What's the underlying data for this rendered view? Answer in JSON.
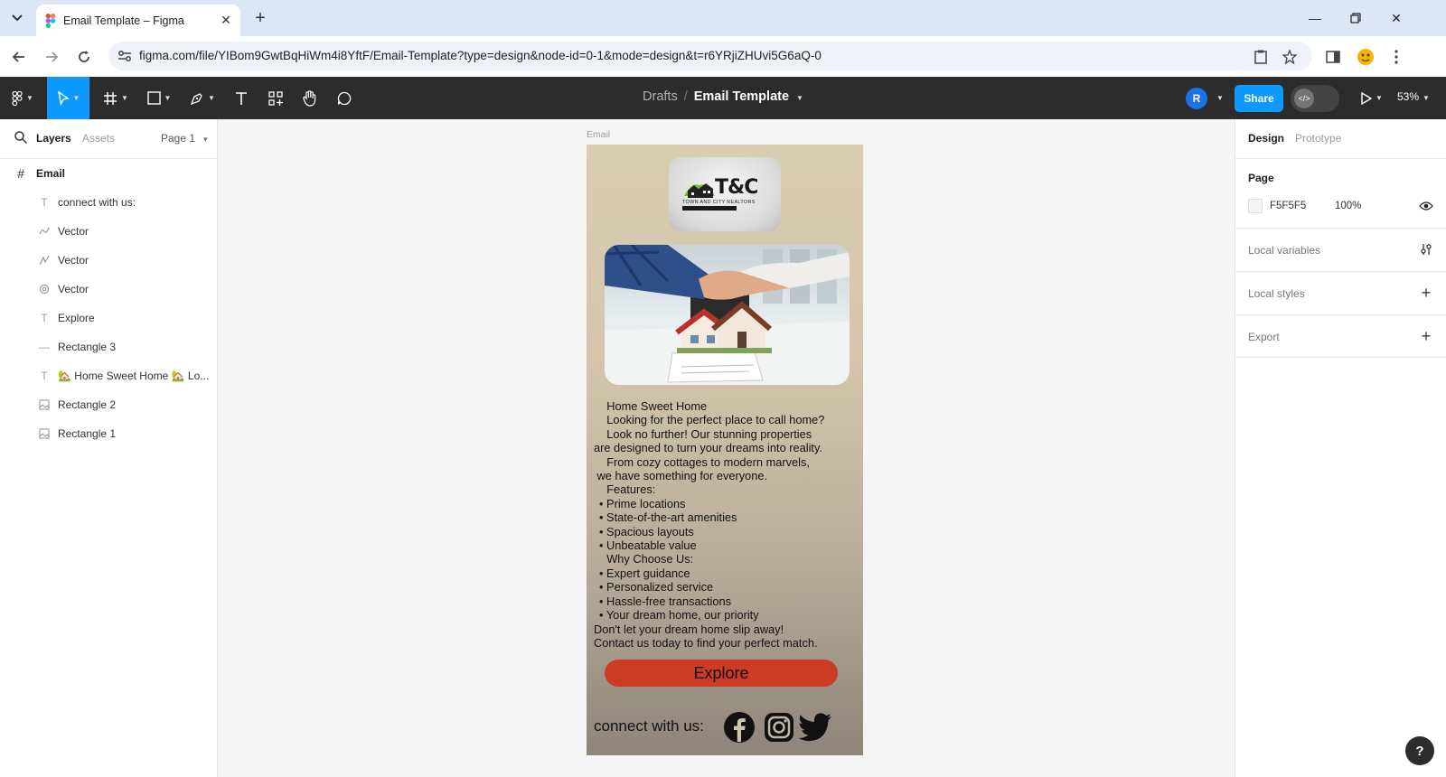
{
  "browser": {
    "tab_title": "Email Template – Figma",
    "url": "figma.com/file/YIBom9GwtBqHiWm4i8YftF/Email-Template?type=design&node-id=0-1&mode=design&t=r6YRjiZHUvi5G6aQ-0"
  },
  "toolbar": {
    "breadcrumb_drafts": "Drafts",
    "breadcrumb_sep": "/",
    "file_name": "Email Template",
    "avatar_initial": "R",
    "share_label": "Share",
    "zoom": "53%"
  },
  "left_panel": {
    "tab_layers": "Layers",
    "tab_assets": "Assets",
    "page_selector": "Page 1",
    "frame_name": "Email",
    "layers": [
      {
        "name": "connect with us:",
        "icon": "text-icon"
      },
      {
        "name": "Vector",
        "icon": "vector-icon"
      },
      {
        "name": "Vector",
        "icon": "vector-icon"
      },
      {
        "name": "Vector",
        "icon": "vector-icon"
      },
      {
        "name": "Explore",
        "icon": "text-icon"
      },
      {
        "name": "Rectangle 3",
        "icon": "rectangle-icon"
      },
      {
        "name": "🏡 Home Sweet Home 🏡 Lo...",
        "icon": "text-icon"
      },
      {
        "name": "Rectangle 2",
        "icon": "image-icon"
      },
      {
        "name": "Rectangle 1",
        "icon": "image-icon"
      }
    ]
  },
  "canvas": {
    "frame_label": "Email",
    "email": {
      "logo_text": "T&C",
      "logo_subtext": "TOWN AND CITY REALTORS",
      "body_lines": [
        {
          "t": "    Home Sweet Home",
          "b": false
        },
        {
          "t": "    Looking for the perfect place to call home?",
          "b": false
        },
        {
          "t": "    Look no further! Our stunning properties",
          "b": false
        },
        {
          "t": "are designed to turn your dreams into reality.",
          "b": false
        },
        {
          "t": "    From cozy cottages to modern marvels,",
          "b": false
        },
        {
          "t": " we have something for everyone.",
          "b": false
        },
        {
          "t": "    Features:",
          "b": false
        },
        {
          "t": "Prime locations",
          "b": true
        },
        {
          "t": "State-of-the-art amenities",
          "b": true
        },
        {
          "t": "Spacious layouts",
          "b": true
        },
        {
          "t": "Unbeatable value",
          "b": true
        },
        {
          "t": "    Why Choose Us:",
          "b": false
        },
        {
          "t": "Expert guidance",
          "b": true
        },
        {
          "t": "Personalized service",
          "b": true
        },
        {
          "t": "Hassle-free transactions",
          "b": true
        },
        {
          "t": "Your dream home, our priority",
          "b": true
        },
        {
          "t": "Don't let your dream home slip away!",
          "b": false
        },
        {
          "t": "Contact us today to find your perfect match.",
          "b": false
        }
      ],
      "explore_label": "Explore",
      "connect_label": "connect with us:",
      "button_color": "#cc3b23"
    }
  },
  "right_panel": {
    "tab_design": "Design",
    "tab_prototype": "Prototype",
    "page_title": "Page",
    "page_color": "F5F5F5",
    "page_opacity": "100%",
    "local_variables": "Local variables",
    "local_styles": "Local styles",
    "export": "Export"
  },
  "help_label": "?"
}
